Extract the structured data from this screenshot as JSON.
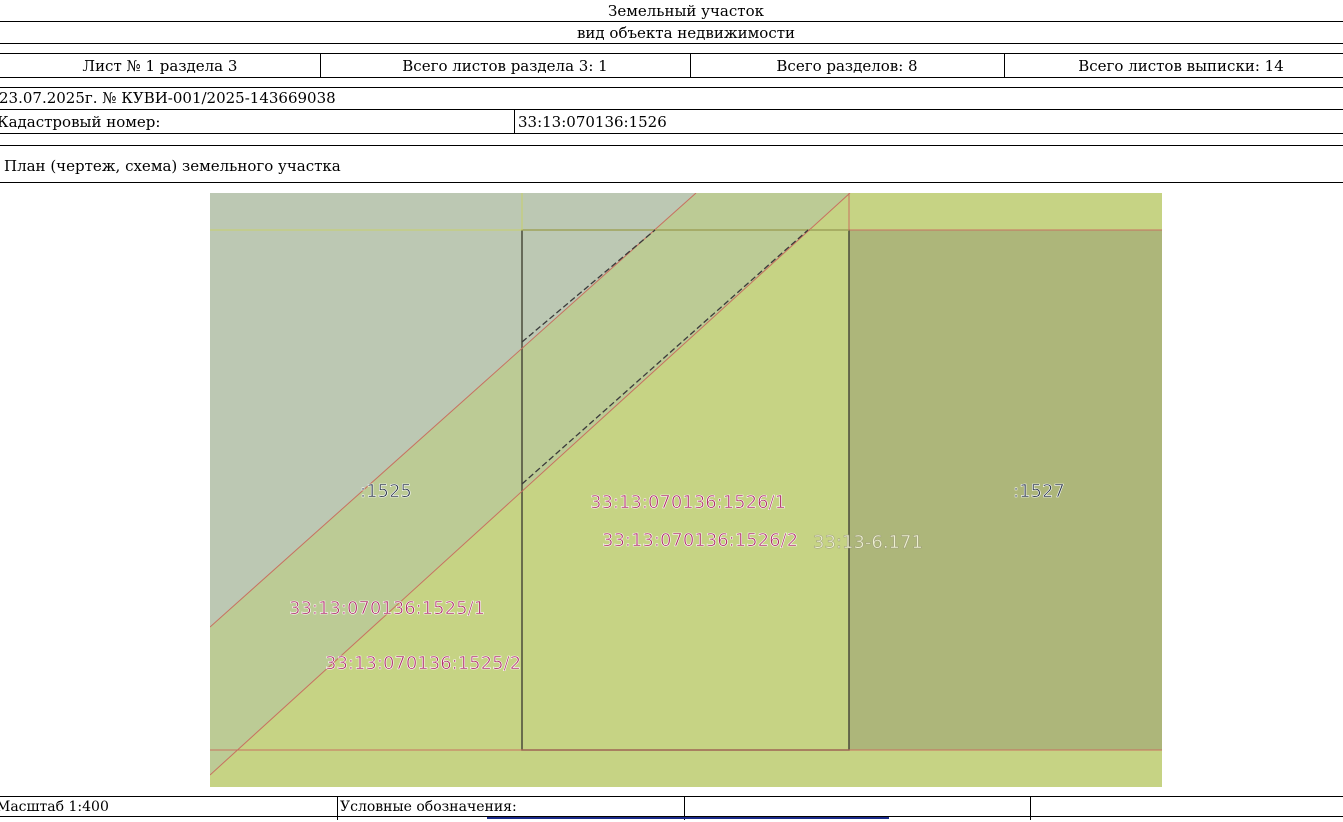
{
  "header": {
    "title": "Земельный участок",
    "subtitle": "вид объекта недвижимости"
  },
  "info_row": {
    "sheet": "Лист № 1 раздела 3",
    "sheets_in_section": "Всего листов раздела 3: 1",
    "sections_total": "Всего разделов: 8",
    "sheets_total": "Всего листов выписки: 14"
  },
  "document": {
    "date_number": "23.07.2025г. № КУВИ-001/2025-143669038",
    "cadastral_label": "Кадастровый номер:",
    "cadastral_value": "33:13:070136:1526"
  },
  "plan": {
    "title": "План (чертеж, схема) земельного участка",
    "labels": {
      "parcel_left": ":1525",
      "parcel_right": ":1527",
      "part_1526_1": "33:13:070136:1526/1",
      "part_1526_2": "33:13:070136:1526/2",
      "zone": "33:13-6.171",
      "part_1525_1": "33:13:070136:1525/1",
      "part_1525_2": "33:13:070136:1525/2"
    },
    "colors": {
      "background": "#c6d384",
      "left_parcel": "#bcc8b3",
      "diagonal_band": "#bccb95",
      "right_parcel": "#adb67a",
      "boundary_red": "#c87060",
      "label_magenta": "#b0306a"
    }
  },
  "footer": {
    "scale": "Масштаб 1:400",
    "legend_label": "Условные обозначения:"
  }
}
